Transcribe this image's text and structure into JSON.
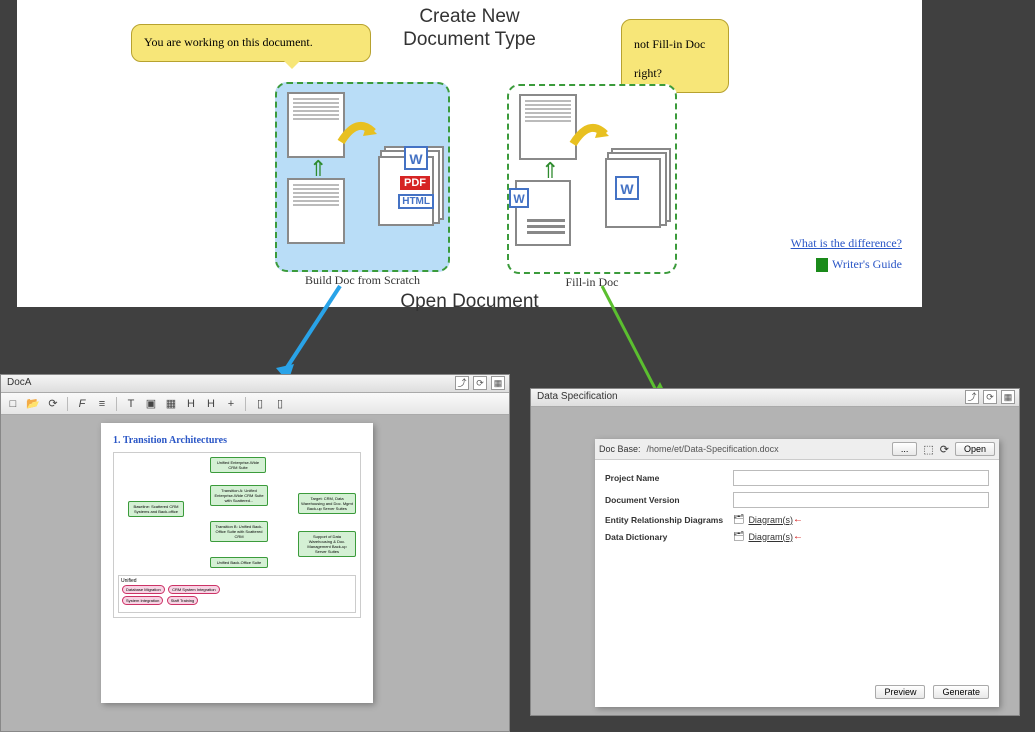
{
  "top": {
    "heading_line1": "Create New",
    "heading_line2": "Document Type",
    "open_doc": "Open Document",
    "bubble1": "You are working on this document.",
    "bubble2_l1": "not   Fill-in Doc",
    "bubble2_l2": "right?",
    "card_build_label": "Build Doc from Scratch",
    "card_fillin_label": "Fill-in Doc",
    "diff_link": "What is the difference?",
    "guide_link": "Writer's Guide",
    "badges": {
      "w": "W",
      "pdf": "PDF",
      "html": "HTML"
    }
  },
  "winA": {
    "title": "DocA",
    "doc_title": "1. Transition Architectures",
    "nodes": {
      "n_top": "Unified Enterprise-Wide CRM Suite",
      "n_left": "Baseline: Scattered CRM Systems and Back-office",
      "n_mid1": "Transition A: Unified Enterprise-Wide CRM Suite with Scattered...",
      "n_mid2": "Transition B: Unified Back-Office Suite with Scattered CRM",
      "n_right": "Target: CRM, Data Warehousing and Doc. Mgmt Back-up Server Suites",
      "n_br": "Support of Data Warehousing & Doc. Management Back-up Server Suites",
      "n_bottom": "Unified Back-Office Suite"
    },
    "unified_label": "Unified",
    "pinks": [
      "Database Migration",
      "CRM System Integration",
      "System Integration",
      "Staff Training"
    ]
  },
  "winB": {
    "title": "Data Specification",
    "doc_base_label": "Doc Base:",
    "doc_base_path": "/home/et/Data-Specification.docx",
    "browse": "...",
    "open": "Open",
    "fields": {
      "project": "Project Name",
      "version": "Document Version",
      "erd": "Entity Relationship Diagrams",
      "dd": "Data Dictionary"
    },
    "diagrams_link": "Diagram(s)",
    "preview": "Preview",
    "generate": "Generate"
  }
}
